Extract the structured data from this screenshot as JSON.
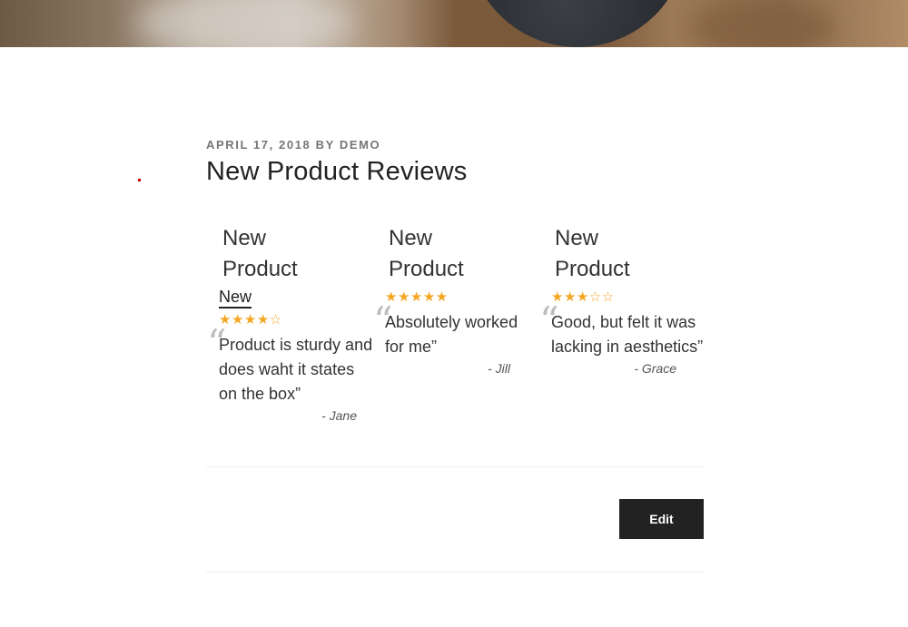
{
  "post": {
    "meta": "APRIL 17, 2018 BY DEMO",
    "title": "New Product Reviews"
  },
  "reviews": [
    {
      "heading_line1": "New",
      "heading_line2": "Product",
      "brand_link": "New",
      "rating_stars": "★★★★☆",
      "rating": 4,
      "quote_mark": "“",
      "text": "Product is sturdy and does waht it states on the box”",
      "reviewer": "- Jane"
    },
    {
      "heading_line1": "New",
      "heading_line2": "Product",
      "rating_stars": "★★★★★",
      "rating": 5,
      "quote_mark": "“",
      "text": "Absolutely worked for me”",
      "reviewer": "- Jill"
    },
    {
      "heading_line1": "New",
      "heading_line2": "Product",
      "rating_stars": "★★★☆☆",
      "rating": 3,
      "quote_mark": "“",
      "text": "Good, but felt it was lacking in aesthetics”",
      "reviewer": "- Grace"
    }
  ],
  "actions": {
    "edit_label": "Edit"
  },
  "colors": {
    "star": "#f5a623",
    "button_bg": "#222222"
  }
}
